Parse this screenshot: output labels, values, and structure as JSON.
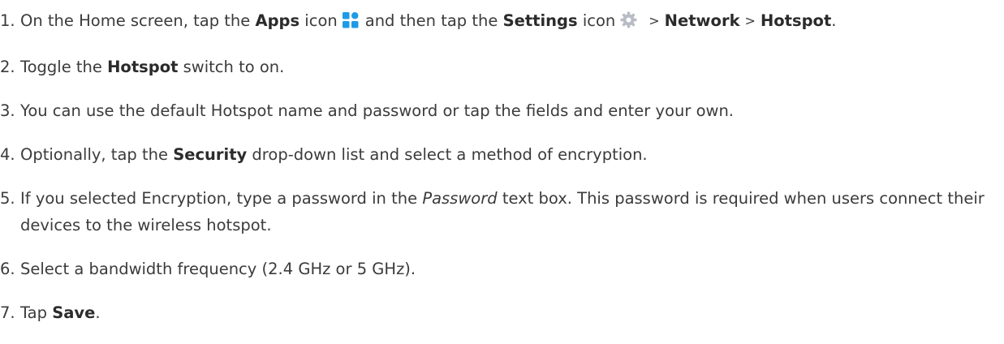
{
  "steps": [
    {
      "num": "1.",
      "t1": "On the Home screen, tap the ",
      "b1": "Apps",
      "t2": " icon",
      "t3": "and then tap the ",
      "b2": "Settings",
      "t4": " icon",
      "sep1": ">",
      "b3": "Network",
      "sep2": ">",
      "b4": "Hotspot",
      "t5": ".",
      "icons": [
        "apps-icon",
        "gear-icon"
      ],
      "apps_icon_color": "#1e9be6",
      "settings_icon_color": "#b9bcc5"
    },
    {
      "num": "2.",
      "t1": "Toggle the ",
      "b1": "Hotspot",
      "t2": " switch to on."
    },
    {
      "num": "3.",
      "t1": "You can use the default Hotspot name and password or tap the fields and enter your own."
    },
    {
      "num": "4.",
      "t1": "Optionally, tap the ",
      "b1": "Security",
      "t2": " drop-down list and select a method of encryption."
    },
    {
      "num": "5.",
      "t1": "If you selected Encryption, type a password in the ",
      "i1": "Password",
      "t2": " text box. This password is required when users connect their devices to the wireless hotspot."
    },
    {
      "num": "6.",
      "t1": "Select a bandwidth frequency (2.4 GHz or 5 GHz)."
    },
    {
      "num": "7.",
      "t1": "Tap ",
      "b1": "Save",
      "t2": "."
    }
  ]
}
